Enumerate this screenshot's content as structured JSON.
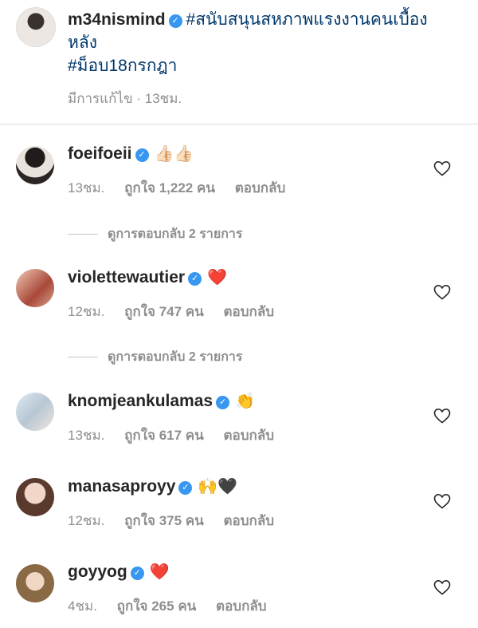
{
  "post": {
    "username": "m34nismind",
    "caption_line1": "#สนับสนุนสหภาพแรงงานคนเบื้อง",
    "caption_line2": "หลัง",
    "caption_line3": "#ม็อบ18กรกฎา",
    "edited": "มีการแก้ไข",
    "separator": "·",
    "time": "13ชม."
  },
  "comments": [
    {
      "username": "foeifoeii",
      "emoji": "👍🏻👍🏻",
      "time": "13ชม.",
      "likes": "ถูกใจ 1,222 คน",
      "reply": "ตอบกลับ",
      "view_replies": "ดูการตอบกลับ 2 รายการ"
    },
    {
      "username": "violettewautier",
      "emoji": "❤️",
      "time": "12ชม.",
      "likes": "ถูกใจ 747 คน",
      "reply": "ตอบกลับ",
      "view_replies": "ดูการตอบกลับ 2 รายการ"
    },
    {
      "username": "knomjeankulamas",
      "emoji": "👏",
      "time": "13ชม.",
      "likes": "ถูกใจ 617 คน",
      "reply": "ตอบกลับ"
    },
    {
      "username": "manasaproyy",
      "emoji": "🙌🖤",
      "time": "12ชม.",
      "likes": "ถูกใจ 375 คน",
      "reply": "ตอบกลับ"
    },
    {
      "username": "goyyog",
      "emoji": "❤️",
      "time": "4ชม.",
      "likes": "ถูกใจ 265 คน",
      "reply": "ตอบกลับ"
    }
  ],
  "colors": {
    "verified": "#3897f0",
    "hashtag": "#00376b",
    "meta": "#8e8e8e"
  },
  "icons": {
    "verified": "verified-badge-icon",
    "like": "heart-outline-icon"
  }
}
